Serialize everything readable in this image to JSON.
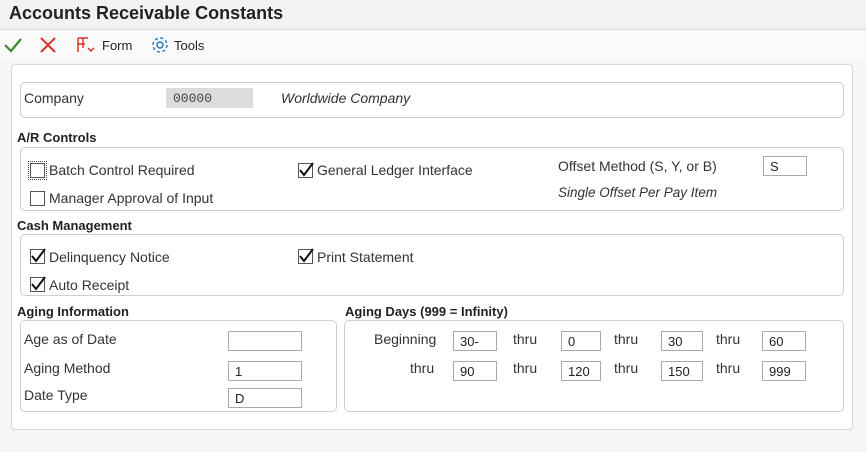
{
  "window": {
    "title": "Accounts Receivable Constants"
  },
  "toolbar": {
    "ok_icon": "checkmark-icon",
    "cancel_icon": "x-icon",
    "form_label": "Form",
    "tools_label": "Tools",
    "ok_color": "#3c8a2e",
    "cancel_color": "#d9342b"
  },
  "company": {
    "label": "Company",
    "value": "00000",
    "name": "Worldwide Company"
  },
  "ar_controls": {
    "title": "A/R Controls",
    "batch_control": {
      "label": "Batch Control Required",
      "checked": false
    },
    "manager_approval": {
      "label": "Manager Approval of Input",
      "checked": false
    },
    "gl_interface": {
      "label": "General Ledger Interface",
      "checked": true
    },
    "offset_method": {
      "label": "Offset Method (S, Y, or B)",
      "value": "S",
      "description": "Single Offset Per Pay Item"
    }
  },
  "cash_management": {
    "title": "Cash Management",
    "delinquency_notice": {
      "label": "Delinquency Notice",
      "checked": true
    },
    "auto_receipt": {
      "label": "Auto Receipt",
      "checked": true
    },
    "print_statement": {
      "label": "Print Statement",
      "checked": true
    }
  },
  "aging_information": {
    "title": "Aging Information",
    "age_as_of_date": {
      "label": "Age as of Date",
      "value": ""
    },
    "aging_method": {
      "label": "Aging Method",
      "value": "1"
    },
    "date_type": {
      "label": "Date Type",
      "value": "D"
    }
  },
  "aging_days": {
    "title": "Aging Days (999 = Infinity)",
    "beginning_label": "Beginning",
    "thru_label": "thru",
    "values": [
      "30-",
      "0",
      "30",
      "60",
      "90",
      "120",
      "150",
      "999"
    ]
  }
}
